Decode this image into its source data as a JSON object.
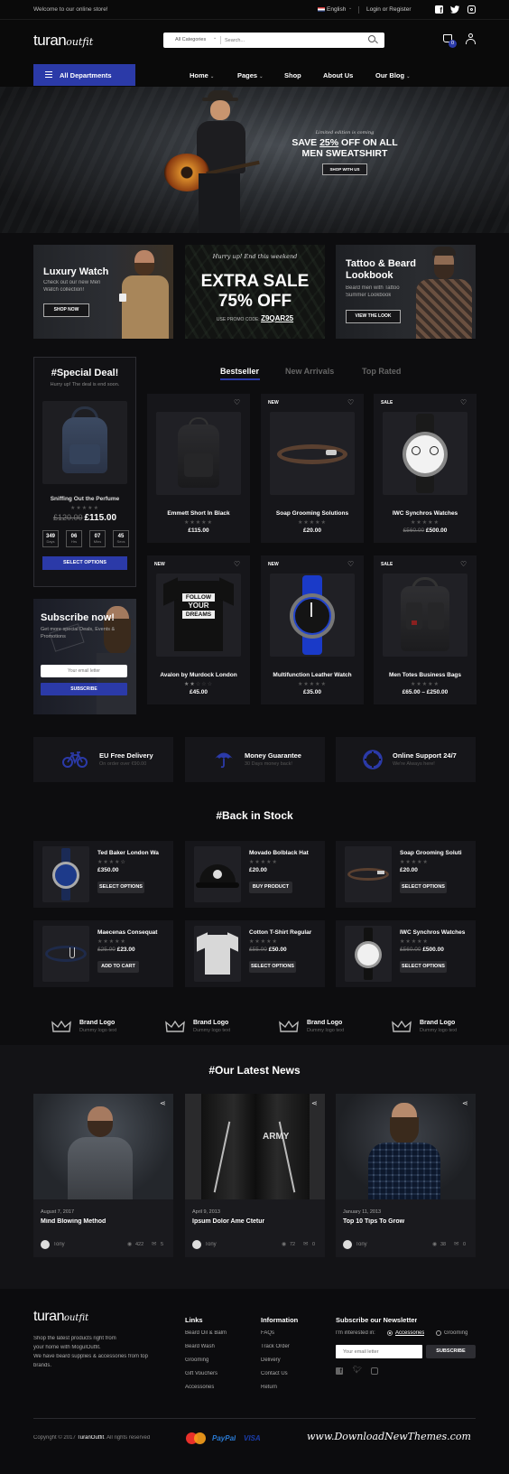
{
  "topbar": {
    "welcome": "Welcome to our online store!",
    "language": "English",
    "account": "Login or Register"
  },
  "header": {
    "logo_main": "turan",
    "logo_script": "outfit",
    "search_category": "All Categories",
    "search_placeholder": "Search...",
    "cart_count": "0"
  },
  "nav": {
    "departments": "All Departments",
    "items": [
      "Home",
      "Pages",
      "Shop",
      "About Us",
      "Our Blog"
    ]
  },
  "hero": {
    "kicker": "Limited edition is coming",
    "line1_pre": "SAVE ",
    "line1_pct": "25%",
    "line1_post": " OFF ON ALL",
    "line2": "MEN SWEATSHIRT",
    "button": "SHOP WITH US"
  },
  "banners": [
    {
      "title": "Luxury Watch",
      "text1": "Check out our new Men",
      "text2": "Watch collection!",
      "button": "SHOP NOW"
    },
    {
      "kicker": "Hurry up! End this weekend",
      "title1": "EXTRA SALE",
      "title2": "75% OFF",
      "promo_label": "USE PROMO CODE:",
      "promo_code": "Z9QAR25"
    },
    {
      "title1": "Tattoo & Beard",
      "title2": "Lookbook",
      "text1": "Beard men with Tattoo",
      "text2": "Summer Lookbook",
      "button": "VIEW THE LOOK"
    }
  ],
  "deal": {
    "title": "#Special Deal!",
    "subtitle": "Hurry up! The deal is end soon.",
    "product": "Sniffing Out the Perfume",
    "old_price": "£120.00",
    "price": "£115.00",
    "countdown": [
      {
        "v": "349",
        "l": "Days"
      },
      {
        "v": "06",
        "l": "Hrs"
      },
      {
        "v": "07",
        "l": "Mins"
      },
      {
        "v": "45",
        "l": "Secs"
      }
    ],
    "button": "SELECT OPTIONS"
  },
  "subscribe": {
    "title": "Subscribe now!",
    "text1": "Get more special Deals, Events &",
    "text2": "Promotions",
    "placeholder": "Your email letter",
    "button": "SUBSCRIBE"
  },
  "tabs": [
    "Bestseller",
    "New Arrivals",
    "Top Rated"
  ],
  "products": [
    {
      "badge": "",
      "name": "Emmett Short In Black",
      "old": "",
      "price": "£115.00"
    },
    {
      "badge": "NEW",
      "name": "Soap Grooming Solutions",
      "old": "",
      "price": "£20.00"
    },
    {
      "badge": "SALE",
      "name": "IWC Synchros Watches",
      "old": "£560.00",
      "price": "£500.00"
    },
    {
      "badge": "NEW",
      "name": "Avalon by Murdock London",
      "old": "",
      "price": "£45.00"
    },
    {
      "badge": "NEW",
      "name": "Multifunction Leather Watch",
      "old": "",
      "price": "£35.00"
    },
    {
      "badge": "SALE",
      "name": "Men Totes Business Bags",
      "old": "",
      "price": "£65.00 – £250.00"
    }
  ],
  "tshirt_print": [
    "FOLLOW",
    "YOUR",
    "DREAMS"
  ],
  "features": [
    {
      "icon": "bicycle-icon",
      "title": "EU Free Delivery",
      "sub": "On order over €90.00"
    },
    {
      "icon": "umbrella-icon",
      "title": "Money Guarantee",
      "sub": "30 Days money back!"
    },
    {
      "icon": "lifebuoy-icon",
      "title": "Online Support 24/7",
      "sub": "We're Always here!"
    }
  ],
  "back_in_stock": {
    "title": "#Back in Stock",
    "items": [
      {
        "name": "Ted Baker London Wa",
        "old": "",
        "price": "£350.00",
        "button": "SELECT OPTIONS"
      },
      {
        "name": "Movado Bolblack Hat",
        "old": "",
        "price": "£20.00",
        "button": "BUY PRODUCT"
      },
      {
        "name": "Soap Grooming Soluti",
        "old": "",
        "price": "£20.00",
        "button": "SELECT OPTIONS"
      },
      {
        "name": "Maecenas Consequat",
        "old": "£25.00",
        "price": "£23.00",
        "button": "ADD TO CART"
      },
      {
        "name": "Cotton T-Shirt Regular",
        "old": "£55.00",
        "price": "£50.00",
        "button": "SELECT OPTIONS"
      },
      {
        "name": "IWC Synchros Watches",
        "old": "£560.00",
        "price": "£500.00",
        "button": "SELECT OPTIONS"
      }
    ]
  },
  "brands": [
    {
      "name": "Brand Logo",
      "sub": "Dummy logo text"
    },
    {
      "name": "Brand Logo",
      "sub": "Dummy logo text"
    },
    {
      "name": "Brand Logo",
      "sub": "Dummy logo text"
    },
    {
      "name": "Brand Logo",
      "sub": "Dummy logo text"
    }
  ],
  "news": {
    "title": "#Our Latest News",
    "posts": [
      {
        "date": "August 7, 2017",
        "title": "Mind Blowing Method",
        "author": "Tony",
        "views": "422",
        "comments": "5"
      },
      {
        "date": "April 9, 2013",
        "title": "Ipsum Dolor Ame Ctetur",
        "author": "Tony",
        "views": "72",
        "comments": "0"
      },
      {
        "date": "January 11, 2013",
        "title": "Top 10 Tips To Grow",
        "author": "Tony",
        "views": "38",
        "comments": "0"
      }
    ]
  },
  "jacket_print": "ARMY",
  "footer": {
    "about": [
      "Shop the latest products right from",
      "your home with MogulOutfit.",
      "We have beard supplies & accessories from top",
      "brands."
    ],
    "links_title": "Links",
    "links": [
      "Beard Oil & Balm",
      "Beard Wash",
      "Grooming",
      "Gift Vouchers",
      "Accessories"
    ],
    "info_title": "Information",
    "info": [
      "FAQs",
      "Track Order",
      "Delivery",
      "Contact Us",
      "Return"
    ],
    "newsletter_title": "Subscribe our Newsletter",
    "interested": "I'm interested in:",
    "options": [
      "Accessories",
      "Grooming"
    ],
    "email_placeholder": "Your email letter",
    "button": "SUBSCRIBE",
    "copy_pre": "Copyright © 2017 ",
    "copy_brand": "TuranOutfit",
    "copy_post": ". All rights reserved",
    "paypal": "PayPal",
    "visa": "VISA",
    "watermark": "www.DownloadNewThemes.com"
  },
  "colors": {
    "accent": "#2b3aa8",
    "bg": "#0d0d0f",
    "card": "#16161a"
  }
}
